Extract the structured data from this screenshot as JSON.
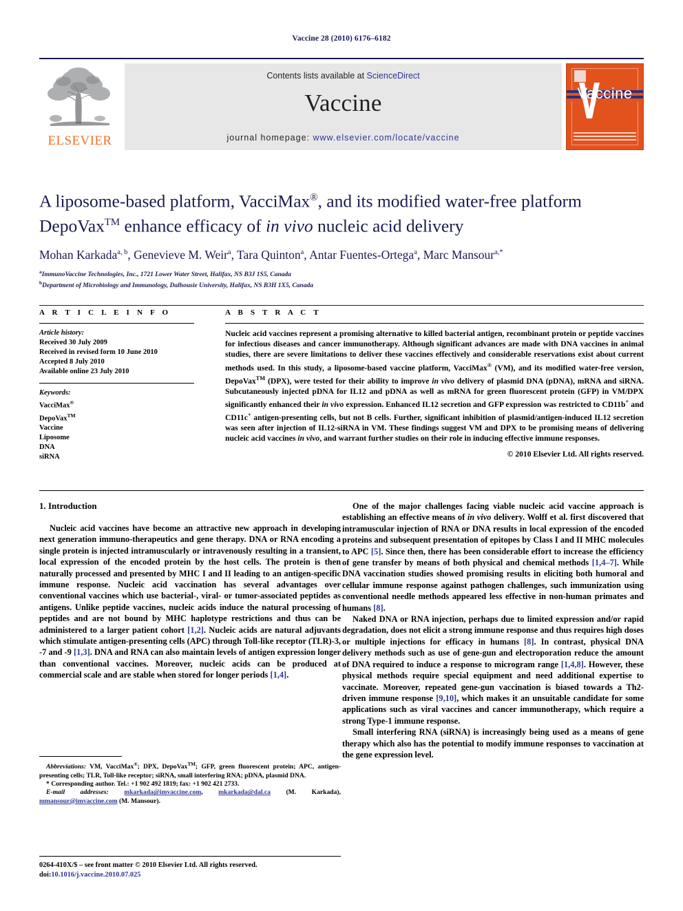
{
  "running_head": "Vaccine 28 (2010) 6176–6182",
  "masthead": {
    "publisher_name": "ELSEVIER",
    "contents_prefix": "Contents lists available at",
    "contents_link": "ScienceDirect",
    "journal_title": "Vaccine",
    "homepage_prefix": "journal homepage:",
    "homepage_url": "www.elsevier.com/locate/vaccine",
    "cover_title": "Vaccine",
    "link_color": "#2d3694",
    "brand_orange": "#ee7326",
    "cover_orange": "#e2521d"
  },
  "title": {
    "line1_a": "A liposome-based platform, VacciMax",
    "line1_sup": "®",
    "line1_b": ", and its modified water-free platform",
    "line2_a": "DepoVax",
    "line2_sup": "TM",
    "line2_b": " enhance efficacy of ",
    "line2_italic": "in vivo",
    "line2_c": " nucleic acid delivery"
  },
  "authors": {
    "list": [
      {
        "name": "Mohan Karkada",
        "sup": "a, b",
        "sep": ", "
      },
      {
        "name": "Genevieve M. Weir",
        "sup": "a",
        "sep": ", "
      },
      {
        "name": "Tara Quinton",
        "sup": "a",
        "sep": ", "
      },
      {
        "name": "Antar Fuentes-Ortega",
        "sup": "a",
        "sep": ", "
      },
      {
        "name": "Marc Mansour",
        "sup": "a,*",
        "sep": ""
      }
    ]
  },
  "affiliations": [
    {
      "sup": "a",
      "text": "ImmunoVaccine Technologies, Inc., 1721 Lower Water Street, Halifax, NS B3J 1S5, Canada"
    },
    {
      "sup": "b",
      "text": "Department of Microbiology and Immunology, Dalhousie University, Halifax, NS B3H 1X5, Canada"
    }
  ],
  "article_info": {
    "heading": "A R T I C L E   I N F O",
    "history_label": "Article history:",
    "history": [
      "Received 30 July 2009",
      "Received in revised form 10 June 2010",
      "Accepted 8 July 2010",
      "Available online 23 July 2010"
    ],
    "keywords_label": "Keywords:",
    "keywords": [
      {
        "text": "VacciMax",
        "sup": "®"
      },
      {
        "text": "DepoVax",
        "sup": "TM"
      },
      {
        "text": "Vaccine",
        "sup": ""
      },
      {
        "text": "Liposome",
        "sup": ""
      },
      {
        "text": "DNA",
        "sup": ""
      },
      {
        "text": "siRNA",
        "sup": ""
      }
    ]
  },
  "abstract": {
    "heading": "A B S T R A C T",
    "part1": "Nucleic acid vaccines represent a promising alternative to killed bacterial antigen, recombinant protein or peptide vaccines for infectious diseases and cancer immunotherapy. Although significant advances are made with DNA vaccines in animal studies, there are severe limitations to deliver these vaccines effectively and considerable reservations exist about current methods used. In this study, a liposome-based vaccine platform, VacciMax",
    "sup1": "®",
    "part2": " (VM), and its modified water-free version, DepoVax",
    "sup2": "TM",
    "part3": " (DPX), were tested for their ability to improve ",
    "ital1": "in vivo",
    "part4": " delivery of plasmid DNA (pDNA), mRNA and siRNA. Subcutaneously injected pDNA for IL12 and pDNA as well as mRNA for green fluorescent protein (GFP) in VM/DPX significantly enhanced their ",
    "ital2": "in vivo",
    "part5": " expression. Enhanced IL12 secretion and GFP expression was restricted to CD11b",
    "sup3": "+",
    "part6": " and CD11c",
    "sup4": "+",
    "part7": " antigen-presenting cells, but not B cells. Further, significant inhibition of plasmid/antigen-induced IL12 secretion was seen after injection of IL12-siRNA in VM. These findings suggest VM and DPX to be promising means of delivering nucleic acid vaccines ",
    "ital3": "in vivo",
    "part8": ", and warrant further studies on their role in inducing effective immune responses.",
    "copyright": "© 2010 Elsevier Ltd. All rights reserved."
  },
  "introduction": {
    "heading": "1.  Introduction",
    "left_paragraphs": [
      {
        "segments": [
          {
            "t": "Nucleic acid vaccines have become an attractive new approach in developing next generation immuno-therapeutics and gene therapy. DNA or RNA encoding a single protein is injected intramuscularly or intravenously resulting in a transient, local expression of the encoded protein by the host cells. The protein is then naturally processed and presented by MHC I and II leading to an antigen-specific immune response. Nucleic acid vaccination has several advantages over conventional vaccines which use bacterial-, viral- or tumor-associated peptides as antigens. Unlike peptide vaccines, nucleic acids induce the natural processing of peptides and are not bound by MHC haplotype restrictions and thus can be administered to a larger patient cohort ",
            "k": "text"
          },
          {
            "t": "[1,2]",
            "k": "cite"
          },
          {
            "t": ". Nucleic acids are natural adjuvants which stimulate antigen-presenting cells (APC) through Toll-like receptor (TLR)-3, -7 and -9 ",
            "k": "text"
          },
          {
            "t": "[1,3]",
            "k": "cite"
          },
          {
            "t": ". DNA and RNA can also maintain levels of antigen expression longer than conventional vaccines. Moreover, nucleic acids can be produced at commercial scale and are stable when stored for longer periods ",
            "k": "text"
          },
          {
            "t": "[1,4]",
            "k": "cite"
          },
          {
            "t": ".",
            "k": "text"
          }
        ]
      }
    ],
    "right_paragraphs": [
      {
        "segments": [
          {
            "t": "One of the major challenges facing viable nucleic acid vaccine approach is establishing an effective means of ",
            "k": "text"
          },
          {
            "t": "in vivo",
            "k": "ital"
          },
          {
            "t": " delivery. Wolff et al. first discovered that intramuscular injection of RNA or DNA results in local expression of the encoded proteins and subsequent presentation of epitopes by Class I and II MHC molecules to APC ",
            "k": "text"
          },
          {
            "t": "[5]",
            "k": "cite"
          },
          {
            "t": ". Since then, there has been considerable effort to increase the efficiency of gene transfer by means of both physical and chemical methods ",
            "k": "text"
          },
          {
            "t": "[1,4–7]",
            "k": "cite"
          },
          {
            "t": ". While DNA vaccination studies showed promising results in eliciting both humoral and cellular immune response against pathogen challenges, such immunization using conventional needle methods appeared less effective in non-human primates and humans ",
            "k": "text"
          },
          {
            "t": "[8]",
            "k": "cite"
          },
          {
            "t": ".",
            "k": "text"
          }
        ]
      },
      {
        "segments": [
          {
            "t": "Naked DNA or RNA injection, perhaps due to limited expression and/or rapid degradation, does not elicit a strong immune response and thus requires high doses or multiple injections for efficacy in humans ",
            "k": "text"
          },
          {
            "t": "[8]",
            "k": "cite"
          },
          {
            "t": ". In contrast, physical DNA delivery methods such as use of gene-gun and electroporation reduce the amount of DNA required to induce a response to microgram range ",
            "k": "text"
          },
          {
            "t": "[1,4,8]",
            "k": "cite"
          },
          {
            "t": ". However, these physical methods require special equipment and need additional expertise to vaccinate. Moreover, repeated gene-gun vaccination is biased towards a Th2-driven immune response ",
            "k": "text"
          },
          {
            "t": "[9,10]",
            "k": "cite"
          },
          {
            "t": ", which makes it an unsuitable candidate for some applications such as viral vaccines and cancer immunotherapy, which require a strong Type-1 immune response.",
            "k": "text"
          }
        ]
      },
      {
        "segments": [
          {
            "t": "Small interfering RNA (siRNA) is increasingly being used as a means of gene therapy which also has the potential to modify immune responses to vaccination at the gene expression level.",
            "k": "text"
          }
        ]
      }
    ]
  },
  "footnotes": {
    "abbrev_label": "Abbreviations:",
    "abbrev_text_a": "  VM, VacciMax",
    "abbrev_sup_a": "®",
    "abbrev_text_b": "; DPX, DepoVax",
    "abbrev_sup_b": "TM",
    "abbrev_text_c": "; GFP, green fluorescent protein; APC, antigen-presenting cells; TLR, Toll-like receptor; siRNA, small interfering RNA; pDNA, plasmid DNA.",
    "corresponding": "* Corresponding author. Tel.: +1 902 492 1819; fax: +1 902 421 2733.",
    "email_label": "E-mail addresses:",
    "email1": "mkarkada@imvaccine.com",
    "email2": "mkarkada@dal.ca",
    "email1_owner": " (M. Karkada),",
    "email3": "mmansour@imvaccine.com",
    "email3_owner": " (M. Mansour)."
  },
  "issn": {
    "line1": "0264-410X/$ – see front matter © 2010 Elsevier Ltd. All rights reserved.",
    "doi_label": "doi:",
    "doi_value": "10.1016/j.vaccine.2010.07.025"
  }
}
